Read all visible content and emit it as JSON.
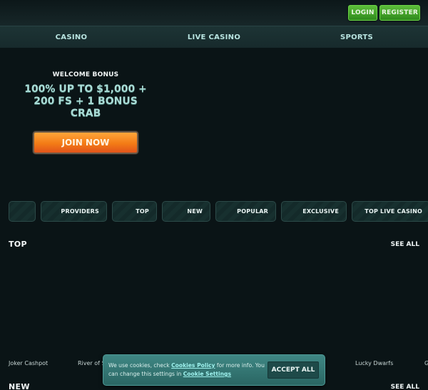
{
  "header": {
    "login_label": "LOGIN",
    "register_label": "REGISTER"
  },
  "nav": {
    "items": [
      {
        "label": "CASINO"
      },
      {
        "label": "LIVE CASINO"
      },
      {
        "label": "SPORTS"
      }
    ]
  },
  "hero": {
    "welcome": "WELCOME BONUS",
    "bonus_line1": "100% UP TO $1,000 +",
    "bonus_line2": "200 FS + 1 BONUS",
    "bonus_line3": "CRAB",
    "cta_label": "JOIN NOW"
  },
  "categories": {
    "items": [
      {
        "label": ""
      },
      {
        "label": "PROVIDERS"
      },
      {
        "label": "TOP"
      },
      {
        "label": "NEW"
      },
      {
        "label": "POPULAR"
      },
      {
        "label": "EXCLUSIVE"
      },
      {
        "label": "TOP LIVE CASINO"
      }
    ]
  },
  "sections": {
    "top": {
      "title": "TOP",
      "see_all": "SEE ALL"
    },
    "new": {
      "title": "NEW",
      "see_all": "SEE ALL"
    }
  },
  "games": [
    {
      "name": "Joker Cashpot"
    },
    {
      "name": "River of St"
    },
    {
      "name": "Lucky Dwarfs"
    },
    {
      "name": "G"
    }
  ],
  "cookie": {
    "text1": "We use cookies, check ",
    "policy_link": "Cookies Policy",
    "text2": " for more info. You can change this settings in ",
    "settings_link": "Cookie Settings",
    "accept_label": "ACCEPT ALL"
  },
  "colors": {
    "background": "#0a1416",
    "accent_green": "#4caf2f",
    "cta_orange": "#f37b16",
    "nav_text": "#b8e4e0",
    "cookie_bg": "#357774"
  }
}
